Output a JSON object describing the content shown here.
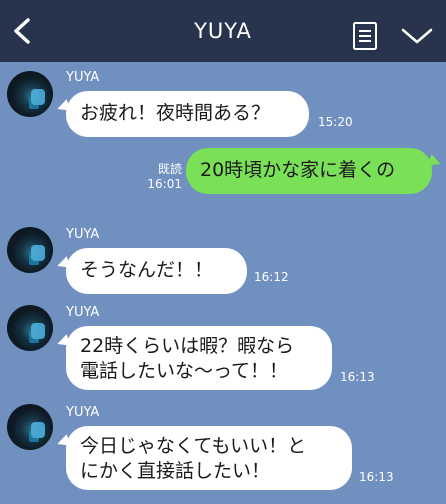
{
  "header": {
    "title": "YUYA",
    "background": "#28344d",
    "icons": [
      "back-chevron-icon",
      "notes-icon",
      "chevron-down-icon"
    ]
  },
  "chat_background": "#7090bf",
  "messages": [
    {
      "sender": "YUYA",
      "text": "お疲れ！夜時間ある？",
      "time": "15:20"
    },
    {
      "read_label": "既読",
      "time": "16:01",
      "text": "20時頃かな家に着くの",
      "bubble_color": "#7ae058"
    },
    {
      "sender": "YUYA",
      "text": "そうなんだ！！",
      "time": "16:12"
    },
    {
      "sender": "YUYA",
      "line1": "22時くらいは暇？暇なら",
      "line2": "電話したいな〜って！！",
      "time": "16:13"
    },
    {
      "sender": "YUYA",
      "line1": "今日じゃなくてもいい！と",
      "line2": "にかく直接話したい！",
      "time": "16:13"
    }
  ]
}
